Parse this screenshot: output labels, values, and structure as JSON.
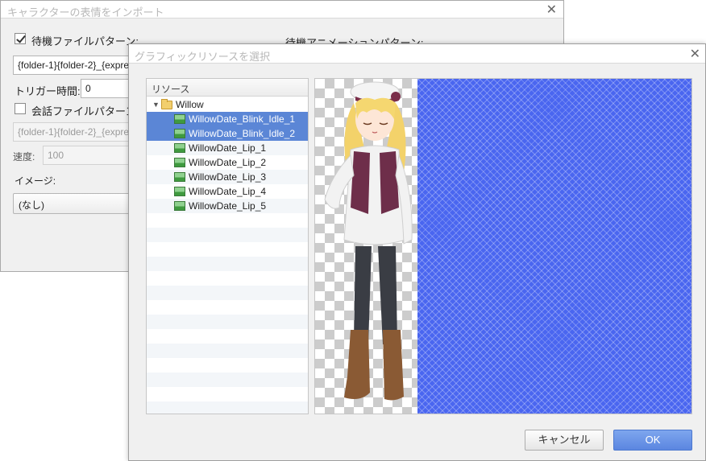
{
  "background_window": {
    "title": "キャラクターの表情をインポート",
    "idle_file_pattern_label": "待機ファイルパターン:",
    "idle_file_pattern_value": "{folder-1}{folder-2}_{expre",
    "idle_animation_pattern_label": "待機アニメーションパターン:",
    "trigger_time_label": "トリガー時間:",
    "trigger_time_value": "0",
    "talk_file_pattern_label": "会話ファイルパターン",
    "talk_file_pattern_value": "{folder-1}{folder-2}_{expre",
    "speed_label": "速度:",
    "speed_value": "100",
    "image_label": "イメージ:",
    "image_value": "(なし)"
  },
  "dialog": {
    "title": "グラフィックリソースを選択",
    "tree_header": "リソース",
    "folder": "Willow",
    "items": [
      {
        "label": "WillowDate_Blink_Idle_1",
        "selected": true
      },
      {
        "label": "WillowDate_Blink_Idle_2",
        "selected": true
      },
      {
        "label": "WillowDate_Lip_1",
        "selected": false
      },
      {
        "label": "WillowDate_Lip_2",
        "selected": false
      },
      {
        "label": "WillowDate_Lip_3",
        "selected": false
      },
      {
        "label": "WillowDate_Lip_4",
        "selected": false
      },
      {
        "label": "WillowDate_Lip_5",
        "selected": false
      }
    ],
    "cancel_label": "キャンセル",
    "ok_label": "OK"
  },
  "colors": {
    "selection": "#5b86d6",
    "preview_blue": "#4a66f0",
    "ok_button": "#6b96e8"
  }
}
